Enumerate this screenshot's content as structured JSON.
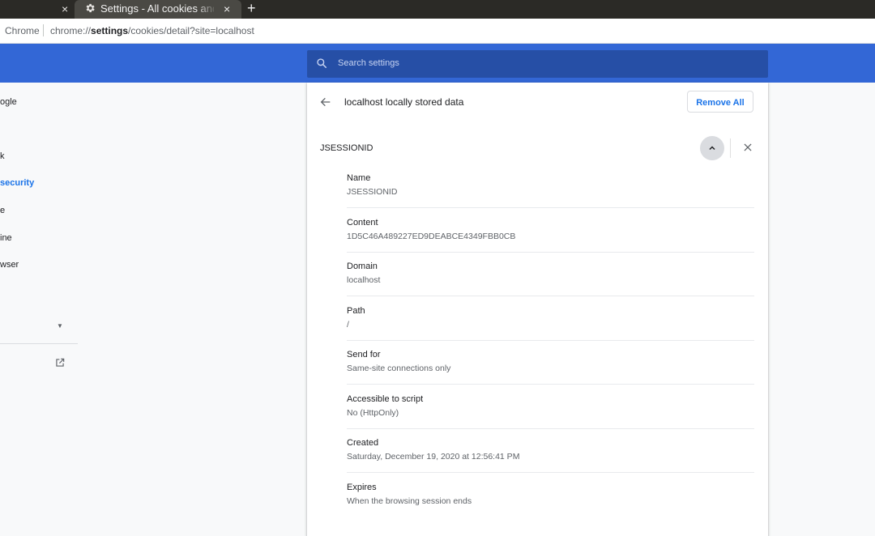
{
  "tabs": {
    "inactive_close": "×",
    "active_title": "Settings - All cookies and site data",
    "active_close": "×",
    "new_tab": "+"
  },
  "omnibox": {
    "label": "Chrome",
    "url_prefix": "chrome://",
    "url_bold": "settings",
    "url_suffix": "/cookies/detail?site=localhost"
  },
  "search": {
    "placeholder": "Search settings"
  },
  "nav": {
    "items": [
      {
        "label": "ogle",
        "active": false
      },
      {
        "label": "k",
        "active": false
      },
      {
        "label": " security",
        "active": true
      },
      {
        "label": "e",
        "active": false
      },
      {
        "label": "ine",
        "active": false
      },
      {
        "label": "wser",
        "active": false
      }
    ]
  },
  "card": {
    "title": "localhost locally stored data",
    "remove_all": "Remove All",
    "cookie_name": "JSESSIONID",
    "fields": [
      {
        "label": "Name",
        "value": "JSESSIONID"
      },
      {
        "label": "Content",
        "value": "1D5C46A489227ED9DEABCE4349FBB0CB"
      },
      {
        "label": "Domain",
        "value": "localhost"
      },
      {
        "label": "Path",
        "value": "/"
      },
      {
        "label": "Send for",
        "value": "Same-site connections only"
      },
      {
        "label": "Accessible to script",
        "value": "No (HttpOnly)"
      },
      {
        "label": "Created",
        "value": "Saturday, December 19, 2020 at 12:56:41 PM"
      },
      {
        "label": "Expires",
        "value": "When the browsing session ends"
      }
    ]
  },
  "colors": {
    "toolbar": "#3367d6",
    "search_box": "#264fa6",
    "accent": "#1a73e8",
    "tabstrip": "#2b2a26"
  }
}
